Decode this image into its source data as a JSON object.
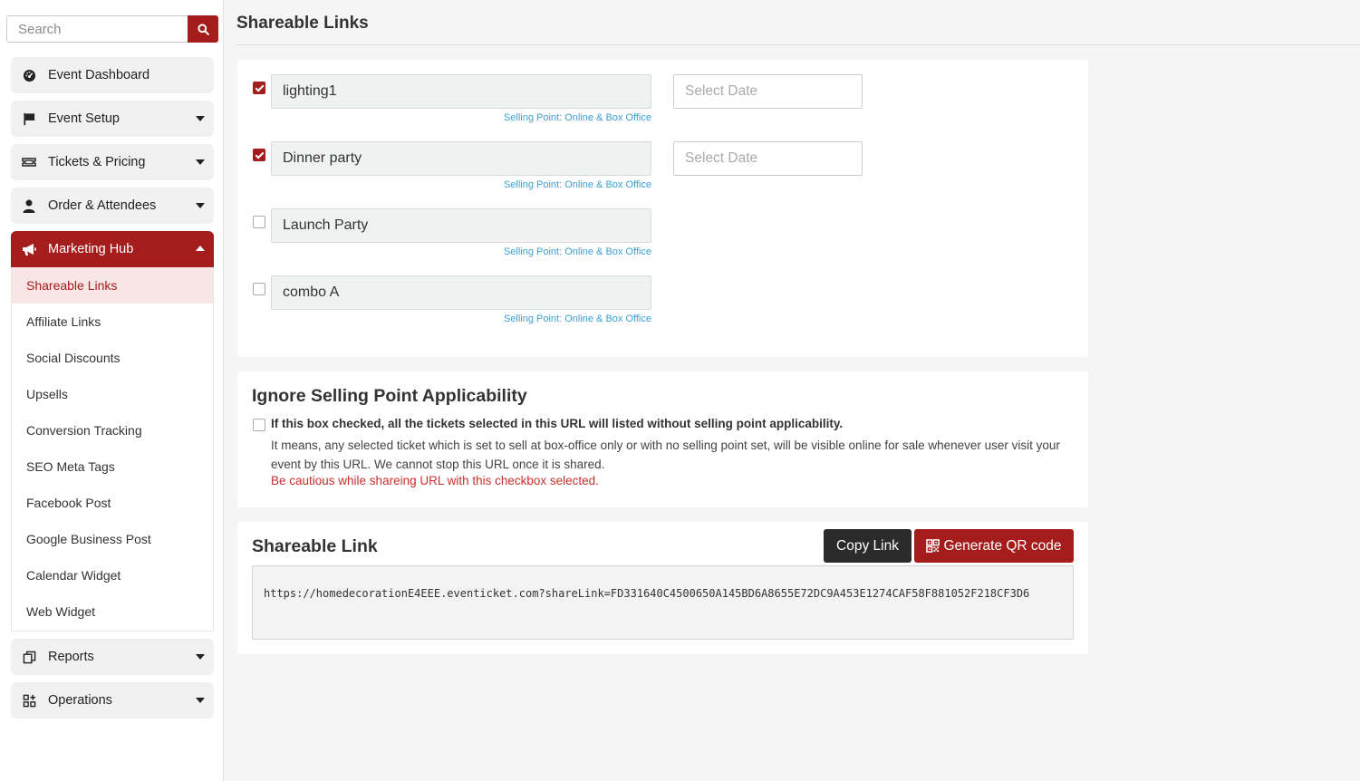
{
  "search": {
    "placeholder": "Search"
  },
  "sidebar": {
    "items": [
      {
        "label": "Event Dashboard",
        "icon": "dashboard-icon"
      },
      {
        "label": "Event Setup",
        "icon": "flag-icon"
      },
      {
        "label": "Tickets & Pricing",
        "icon": "ticket-icon"
      },
      {
        "label": "Order & Attendees",
        "icon": "user-icon"
      },
      {
        "label": "Marketing Hub",
        "icon": "megaphone-icon"
      },
      {
        "label": "Reports",
        "icon": "reports-icon"
      },
      {
        "label": "Operations",
        "icon": "operations-icon"
      }
    ],
    "submenu": [
      "Shareable Links",
      "Affiliate Links",
      "Social Discounts",
      "Upsells",
      "Conversion Tracking",
      "SEO Meta Tags",
      "Facebook Post",
      "Google Business Post",
      "Calendar Widget",
      "Web Widget"
    ]
  },
  "page": {
    "title": "Shareable Links"
  },
  "tickets": [
    {
      "name": "lighting1",
      "checked": true,
      "selling_point": "Selling Point: Online & Box Office",
      "date_placeholder": "Select Date"
    },
    {
      "name": "Dinner party",
      "checked": true,
      "selling_point": "Selling Point: Online & Box Office",
      "date_placeholder": "Select Date"
    },
    {
      "name": "Launch Party",
      "checked": false,
      "selling_point": "Selling Point: Online & Box Office"
    },
    {
      "name": "combo A",
      "checked": false,
      "selling_point": "Selling Point: Online & Box Office"
    }
  ],
  "ignore": {
    "heading": "Ignore Selling Point Applicability",
    "bold": "If this box checked, all the tickets selected in this URL will listed without selling point applicability.",
    "text": "It means, any selected ticket which is set to sell at box-office only or with no selling point set, will be visible online for sale whenever user visit your event by this URL. We cannot stop this URL once it is shared.",
    "warning": "Be cautious while shareing URL with this checkbox selected."
  },
  "share": {
    "heading": "Shareable Link",
    "copy_label": "Copy Link",
    "qr_label": "Generate QR code",
    "url": "https://homedecorationE4EEE.eventicket.com?shareLink=FD331640C4500650A145BD6A8655E72DC9A453E1274CAF58F881052F218CF3D6"
  },
  "colors": {
    "accent": "#a51c1c",
    "link_blue": "#3a9fd8",
    "warning_red": "#c9302c",
    "dark_button": "#2b2b2b"
  }
}
